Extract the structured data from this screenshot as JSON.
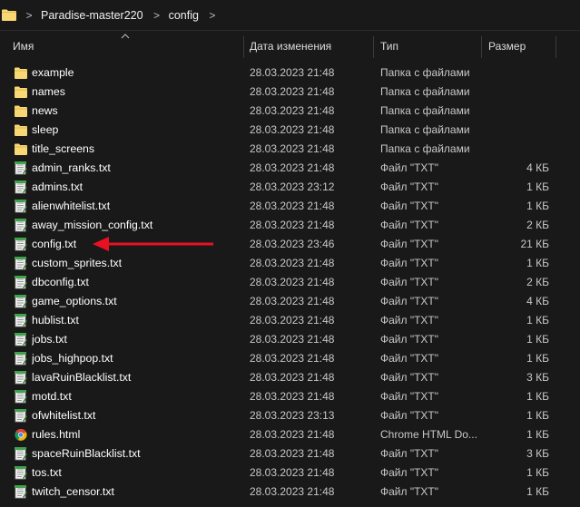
{
  "breadcrumb": {
    "items": [
      "Paradise-master220",
      "config"
    ]
  },
  "columns": {
    "name": "Имя",
    "date": "Дата изменения",
    "type": "Тип",
    "size": "Размер"
  },
  "icons": {
    "folder": "folder-icon",
    "text": "text-file-icon",
    "chrome": "chrome-html-icon"
  },
  "colors": {
    "background": "#191919",
    "folder": "#f8d775",
    "arrow": "#e81123"
  },
  "files": [
    {
      "name": "example",
      "date": "28.03.2023 21:48",
      "type": "Папка с файлами",
      "size": "",
      "icon": "folder"
    },
    {
      "name": "names",
      "date": "28.03.2023 21:48",
      "type": "Папка с файлами",
      "size": "",
      "icon": "folder"
    },
    {
      "name": "news",
      "date": "28.03.2023 21:48",
      "type": "Папка с файлами",
      "size": "",
      "icon": "folder"
    },
    {
      "name": "sleep",
      "date": "28.03.2023 21:48",
      "type": "Папка с файлами",
      "size": "",
      "icon": "folder"
    },
    {
      "name": "title_screens",
      "date": "28.03.2023 21:48",
      "type": "Папка с файлами",
      "size": "",
      "icon": "folder"
    },
    {
      "name": "admin_ranks.txt",
      "date": "28.03.2023 21:48",
      "type": "Файл \"TXT\"",
      "size": "4 КБ",
      "icon": "text"
    },
    {
      "name": "admins.txt",
      "date": "28.03.2023 23:12",
      "type": "Файл \"TXT\"",
      "size": "1 КБ",
      "icon": "text"
    },
    {
      "name": "alienwhitelist.txt",
      "date": "28.03.2023 21:48",
      "type": "Файл \"TXT\"",
      "size": "1 КБ",
      "icon": "text"
    },
    {
      "name": "away_mission_config.txt",
      "date": "28.03.2023 21:48",
      "type": "Файл \"TXT\"",
      "size": "2 КБ",
      "icon": "text"
    },
    {
      "name": "config.txt",
      "date": "28.03.2023 23:46",
      "type": "Файл \"TXT\"",
      "size": "21 КБ",
      "icon": "text"
    },
    {
      "name": "custom_sprites.txt",
      "date": "28.03.2023 21:48",
      "type": "Файл \"TXT\"",
      "size": "1 КБ",
      "icon": "text"
    },
    {
      "name": "dbconfig.txt",
      "date": "28.03.2023 21:48",
      "type": "Файл \"TXT\"",
      "size": "2 КБ",
      "icon": "text"
    },
    {
      "name": "game_options.txt",
      "date": "28.03.2023 21:48",
      "type": "Файл \"TXT\"",
      "size": "4 КБ",
      "icon": "text"
    },
    {
      "name": "hublist.txt",
      "date": "28.03.2023 21:48",
      "type": "Файл \"TXT\"",
      "size": "1 КБ",
      "icon": "text"
    },
    {
      "name": "jobs.txt",
      "date": "28.03.2023 21:48",
      "type": "Файл \"TXT\"",
      "size": "1 КБ",
      "icon": "text"
    },
    {
      "name": "jobs_highpop.txt",
      "date": "28.03.2023 21:48",
      "type": "Файл \"TXT\"",
      "size": "1 КБ",
      "icon": "text"
    },
    {
      "name": "lavaRuinBlacklist.txt",
      "date": "28.03.2023 21:48",
      "type": "Файл \"TXT\"",
      "size": "3 КБ",
      "icon": "text"
    },
    {
      "name": "motd.txt",
      "date": "28.03.2023 21:48",
      "type": "Файл \"TXT\"",
      "size": "1 КБ",
      "icon": "text"
    },
    {
      "name": "ofwhitelist.txt",
      "date": "28.03.2023 23:13",
      "type": "Файл \"TXT\"",
      "size": "1 КБ",
      "icon": "text"
    },
    {
      "name": "rules.html",
      "date": "28.03.2023 21:48",
      "type": "Chrome HTML Do...",
      "size": "1 КБ",
      "icon": "chrome"
    },
    {
      "name": "spaceRuinBlacklist.txt",
      "date": "28.03.2023 21:48",
      "type": "Файл \"TXT\"",
      "size": "3 КБ",
      "icon": "text"
    },
    {
      "name": "tos.txt",
      "date": "28.03.2023 21:48",
      "type": "Файл \"TXT\"",
      "size": "1 КБ",
      "icon": "text"
    },
    {
      "name": "twitch_censor.txt",
      "date": "28.03.2023 21:48",
      "type": "Файл \"TXT\"",
      "size": "1 КБ",
      "icon": "text"
    }
  ]
}
